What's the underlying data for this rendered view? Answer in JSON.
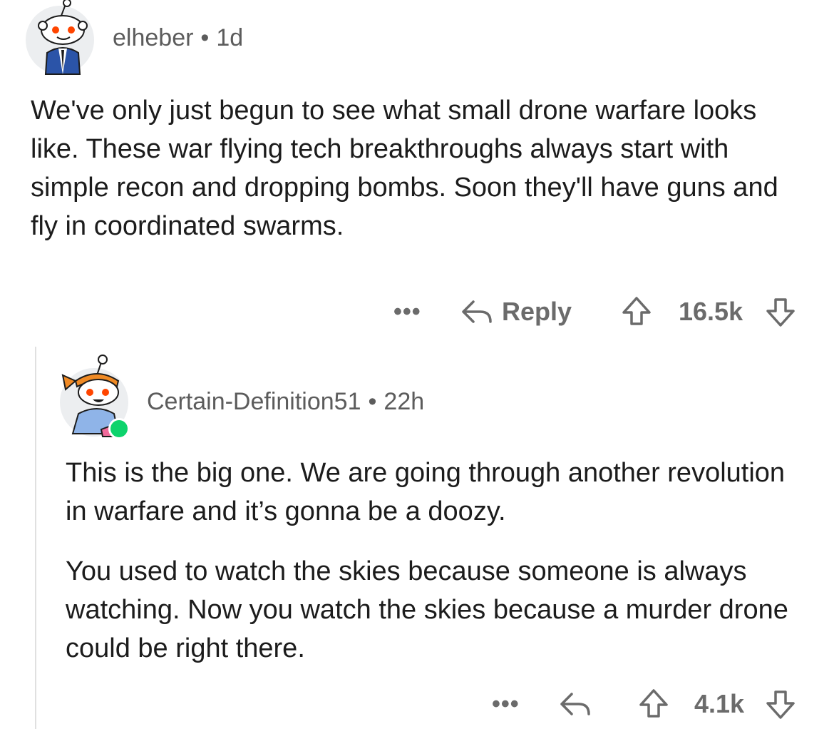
{
  "comments": [
    {
      "username": "elheber",
      "separator": "•",
      "age": "1d",
      "paragraphs": [
        "We've only just begun to see what small drone warfare looks like. These war flying tech breakthroughs always start with simple recon and dropping bombs. Soon they'll have guns and fly in coordinated swarms."
      ],
      "more_label": "•••",
      "reply_label": "Reply",
      "score": "16.5k"
    },
    {
      "username": "Certain-Definition51",
      "separator": "•",
      "age": "22h",
      "paragraphs": [
        "This is the big one. We are going through another revolution in warfare and it’s gonna be a doozy.",
        "You used to watch the skies because someone is always watching. Now you watch the skies because a murder drone could be right there."
      ],
      "more_label": "•••",
      "score": "4.1k",
      "online": true
    }
  ],
  "colors": {
    "text": "#1c1c1c",
    "meta": "#5c5c5c",
    "icon": "#6b6b6b",
    "online": "#0dd36c",
    "snoo_eye": "#ff4500"
  }
}
